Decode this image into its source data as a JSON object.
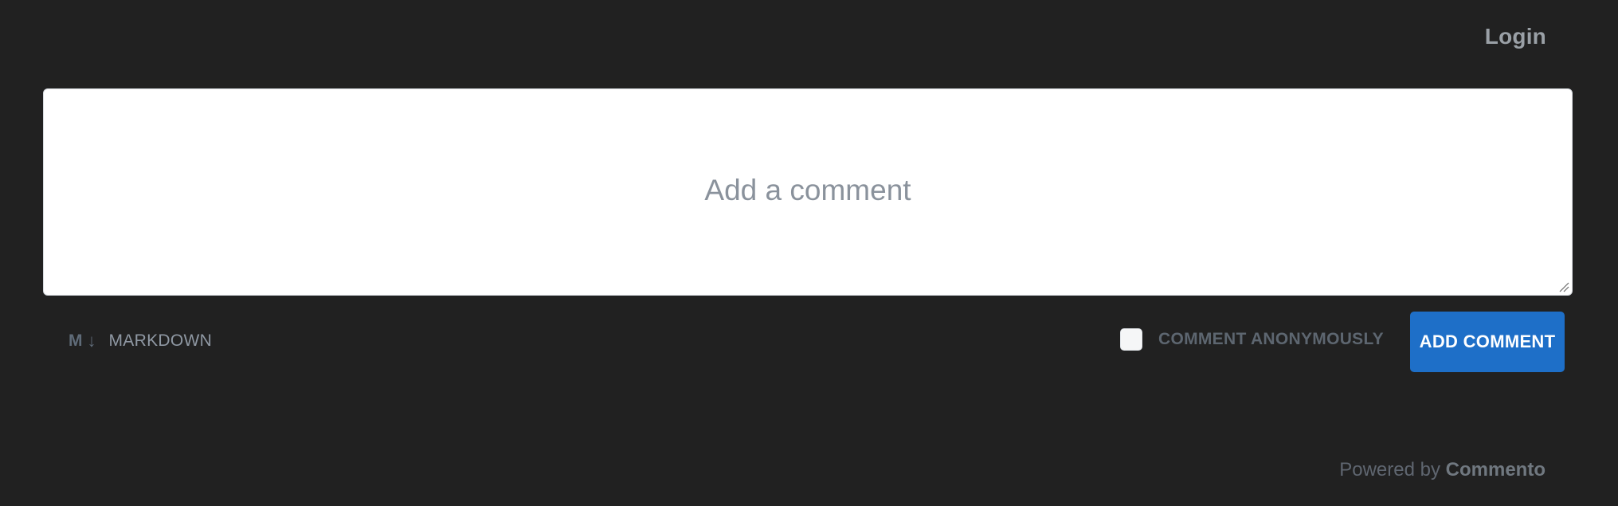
{
  "header": {
    "login_label": "Login"
  },
  "comment_box": {
    "placeholder": "Add a comment",
    "value": ""
  },
  "markdown": {
    "logo_letter": "M",
    "logo_arrow": "↓",
    "label": "MARKDOWN"
  },
  "anonymous": {
    "label": "COMMENT ANONYMOUSLY",
    "checked": false
  },
  "submit": {
    "label": "ADD COMMENT"
  },
  "footer": {
    "powered_by": "Powered by",
    "brand": "Commento"
  },
  "colors": {
    "background": "#212121",
    "accent": "#1e6fc8",
    "textarea_bg": "#ffffff"
  },
  "icons": {
    "markdown": "markdown-icon",
    "resize": "resize-handle-icon",
    "checkbox": "checkbox-unchecked-icon"
  }
}
